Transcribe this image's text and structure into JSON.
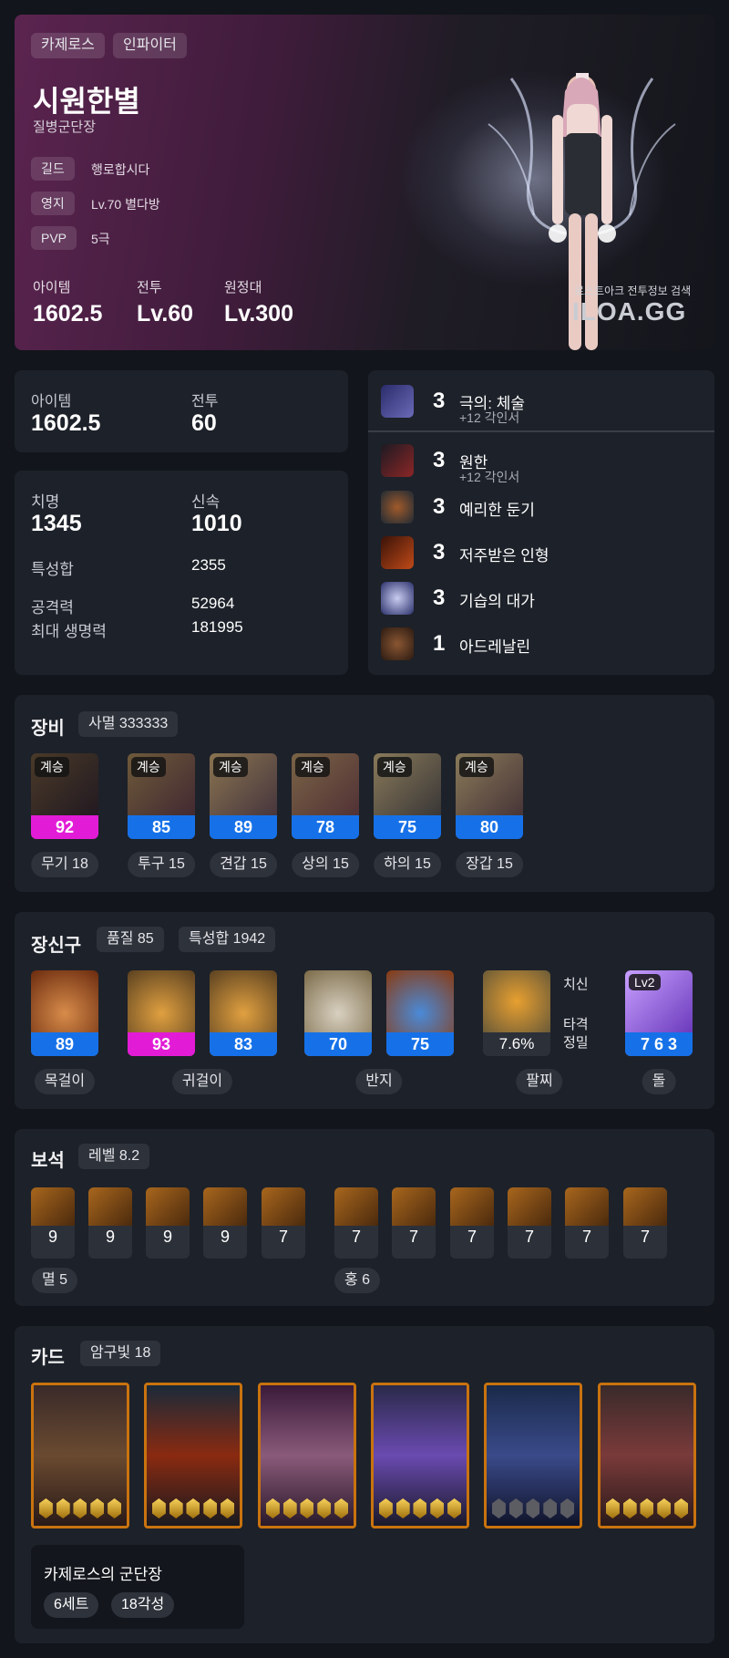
{
  "profile": {
    "server": "카제로스",
    "class": "인파이터",
    "name": "시원한별",
    "title": "질병군단장",
    "info": [
      {
        "label": "길드",
        "value": "행로합시다"
      },
      {
        "label": "영지",
        "value": "Lv.70 별다방"
      },
      {
        "label": "PVP",
        "value": "5극"
      }
    ],
    "stats": [
      {
        "label": "아이템",
        "value": "1602.5"
      },
      {
        "label": "전투",
        "value": "Lv.60"
      },
      {
        "label": "원정대",
        "value": "Lv.300"
      }
    ],
    "watermark_sub": "로스트아크 전투정보 검색",
    "watermark_logo": "ILOA.GG"
  },
  "levels": {
    "item_label": "아이템",
    "item_value": "1602.5",
    "combat_label": "전투",
    "combat_value": "60"
  },
  "stats": {
    "crit_label": "치명",
    "crit_value": "1345",
    "swift_label": "신속",
    "swift_value": "1010",
    "total_label": "특성합",
    "total_value": "2355",
    "atk_label": "공격력",
    "atk_value": "52964",
    "hp_label": "최대 생명력",
    "hp_value": "181995"
  },
  "engravings": [
    {
      "level": "3",
      "name": "극의: 체술",
      "sub": "+12 각인서",
      "icon_color": "#6a6ab8"
    },
    {
      "level": "3",
      "name": "원한",
      "sub": "+12 각인서",
      "icon_color": "#8c2626"
    },
    {
      "level": "3",
      "name": "예리한 둔기",
      "sub": "",
      "icon_color": "#4b3d2a"
    },
    {
      "level": "3",
      "name": "저주받은 인형",
      "sub": "",
      "icon_color": "#a83b12"
    },
    {
      "level": "3",
      "name": "기습의 대가",
      "sub": "",
      "icon_color": "#4c5ab0"
    },
    {
      "level": "1",
      "name": "아드레날린",
      "sub": "",
      "icon_color": "#6a3a20"
    }
  ],
  "equipment": {
    "label": "장비",
    "set_chip": "사멸 333333",
    "items": [
      {
        "tag": "계승",
        "quality": "92",
        "name": "무기 18",
        "quality_color": "mag",
        "icon": "weapon-icon"
      },
      {
        "tag": "계승",
        "quality": "85",
        "name": "투구 15",
        "quality_color": "blue",
        "icon": "helmet-icon"
      },
      {
        "tag": "계승",
        "quality": "89",
        "name": "견갑 15",
        "quality_color": "blue",
        "icon": "shoulder-icon"
      },
      {
        "tag": "계승",
        "quality": "78",
        "name": "상의 15",
        "quality_color": "blue",
        "icon": "chest-icon"
      },
      {
        "tag": "계승",
        "quality": "75",
        "name": "하의 15",
        "quality_color": "blue",
        "icon": "pants-icon"
      },
      {
        "tag": "계승",
        "quality": "80",
        "name": "장갑 15",
        "quality_color": "blue",
        "icon": "gloves-icon"
      }
    ]
  },
  "accessories": {
    "label": "장신구",
    "quality_chip": "품질 85",
    "stat_chip": "특성합 1942",
    "values": [
      "89",
      "93",
      "83",
      "70",
      "75"
    ],
    "bracelet_value": "7.6%",
    "bracelet_stats": [
      "치신",
      "타격",
      "정밀"
    ],
    "stone_level": "Lv2",
    "stone_value": "7 6 3",
    "names": [
      "목걸이",
      "귀걸이",
      "반지",
      "팔찌",
      "돌"
    ]
  },
  "gems": {
    "label": "보석",
    "level_chip": "레벨 8.2",
    "left": [
      "9",
      "9",
      "9",
      "9",
      "7"
    ],
    "right": [
      "7",
      "7",
      "7",
      "7",
      "7",
      "7"
    ],
    "left_label": "멸 5",
    "right_label": "홍 6"
  },
  "cards": {
    "label": "카드",
    "awaken_chip": "암구빛 18",
    "stars": [
      5,
      5,
      5,
      5,
      0,
      5
    ],
    "set_name": "카제로스의 군단장",
    "set_count": "6세트",
    "set_awaken": "18각성"
  }
}
